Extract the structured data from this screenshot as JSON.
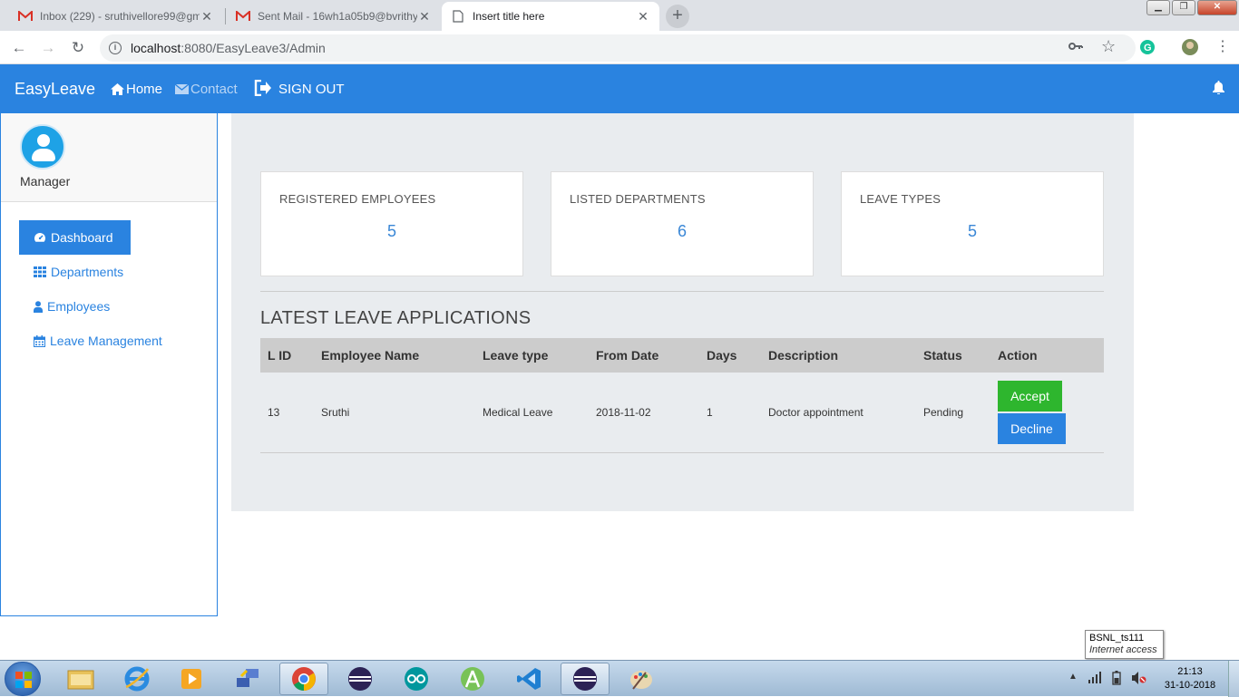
{
  "browser": {
    "tabs": [
      {
        "title": "Inbox (229) - sruthivellore99@gm",
        "icon": "gmail-icon"
      },
      {
        "title": "Sent Mail - 16wh1a05b9@bvrithy",
        "icon": "gmail-icon"
      },
      {
        "title": "Insert title here",
        "icon": "page-icon"
      }
    ],
    "url_host": "localhost",
    "url_path": ":8080/EasyLeave3/Admin"
  },
  "nav": {
    "brand": "EasyLeave",
    "home": "Home",
    "contact": "Contact",
    "signout": "SIGN OUT"
  },
  "sidebar": {
    "role": "Manager",
    "items": [
      {
        "label": "Dashboard",
        "icon": "dashboard-icon"
      },
      {
        "label": "Departments",
        "icon": "grid-icon"
      },
      {
        "label": "Employees",
        "icon": "user-icon"
      },
      {
        "label": "Leave Management",
        "icon": "calendar-icon"
      }
    ]
  },
  "stats": [
    {
      "label": "REGISTERED EMPLOYEES",
      "value": "5"
    },
    {
      "label": "LISTED DEPARTMENTS",
      "value": "6"
    },
    {
      "label": "LEAVE TYPES",
      "value": "5"
    }
  ],
  "leaves": {
    "title": "LATEST LEAVE APPLICATIONS",
    "columns": [
      "L ID",
      "Employee Name",
      "Leave type",
      "From Date",
      "Days",
      "Description",
      "Status",
      "Action"
    ],
    "rows": [
      {
        "id": "13",
        "name": "Sruthi",
        "type": "Medical Leave",
        "from": "2018-11-02",
        "days": "1",
        "description": "Doctor appointment",
        "status": "Pending"
      }
    ],
    "accept_label": "Accept",
    "decline_label": "Decline"
  },
  "tooltip": {
    "network": "BSNL_ts111",
    "status": "Internet access"
  },
  "taskbar": {
    "time": "21:13",
    "date": "31-10-2018"
  },
  "colors": {
    "primary": "#2a83e0",
    "accept": "#2eb62e",
    "panel": "#e9ecef"
  }
}
